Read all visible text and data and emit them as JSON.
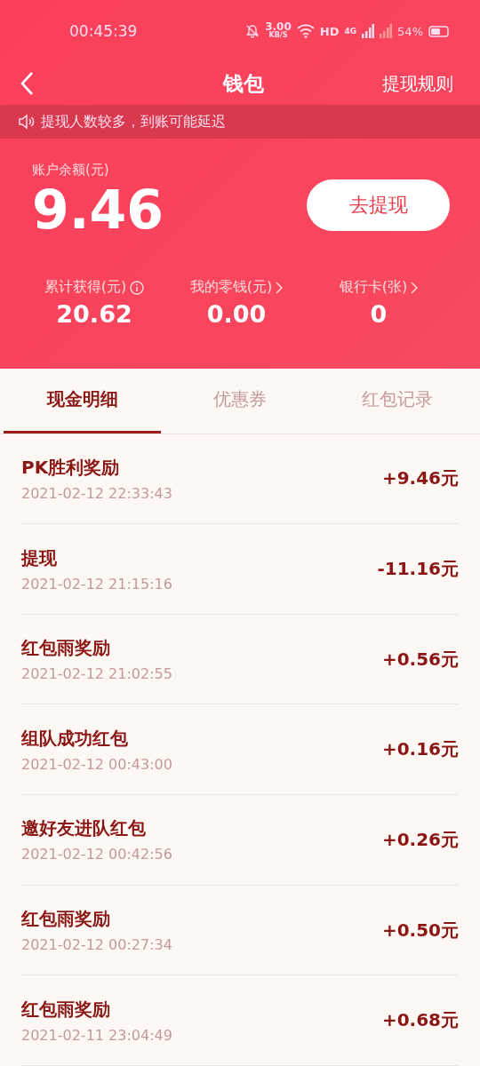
{
  "status_bar": {
    "time": "00:45:39",
    "speed": "3.00",
    "speed_unit": "KB/S",
    "hd": "HD",
    "network": "4G",
    "battery": "54%"
  },
  "nav": {
    "title": "钱包",
    "action": "提现规则"
  },
  "notice": "提现人数较多，到账可能延迟",
  "balance": {
    "label": "账户余额(元)",
    "amount": "9.46",
    "button": "去提现"
  },
  "stats": [
    {
      "label": "累计获得(元)",
      "value": "20.62",
      "kind": "info"
    },
    {
      "label": "我的零钱(元)",
      "value": "0.00",
      "kind": "link"
    },
    {
      "label": "银行卡(张)",
      "value": "0",
      "kind": "link"
    }
  ],
  "tabs": [
    {
      "label": "现金明细",
      "selected": true
    },
    {
      "label": "优惠券",
      "selected": false
    },
    {
      "label": "红包记录",
      "selected": false
    }
  ],
  "transactions": [
    {
      "title": "PK胜利奖励",
      "time": "2021-02-12 22:33:43",
      "amount": "+9.46元"
    },
    {
      "title": "提现",
      "time": "2021-02-12 21:15:16",
      "amount": "-11.16元"
    },
    {
      "title": "红包雨奖励",
      "time": "2021-02-12 21:02:55",
      "amount": "+0.56元"
    },
    {
      "title": "组队成功红包",
      "time": "2021-02-12 00:43:00",
      "amount": "+0.16元"
    },
    {
      "title": "邀好友进队红包",
      "time": "2021-02-12 00:42:56",
      "amount": "+0.26元"
    },
    {
      "title": "红包雨奖励",
      "time": "2021-02-12 00:27:34",
      "amount": "+0.50元"
    },
    {
      "title": "红包雨奖励",
      "time": "2021-02-11 23:04:49",
      "amount": "+0.68元"
    }
  ]
}
